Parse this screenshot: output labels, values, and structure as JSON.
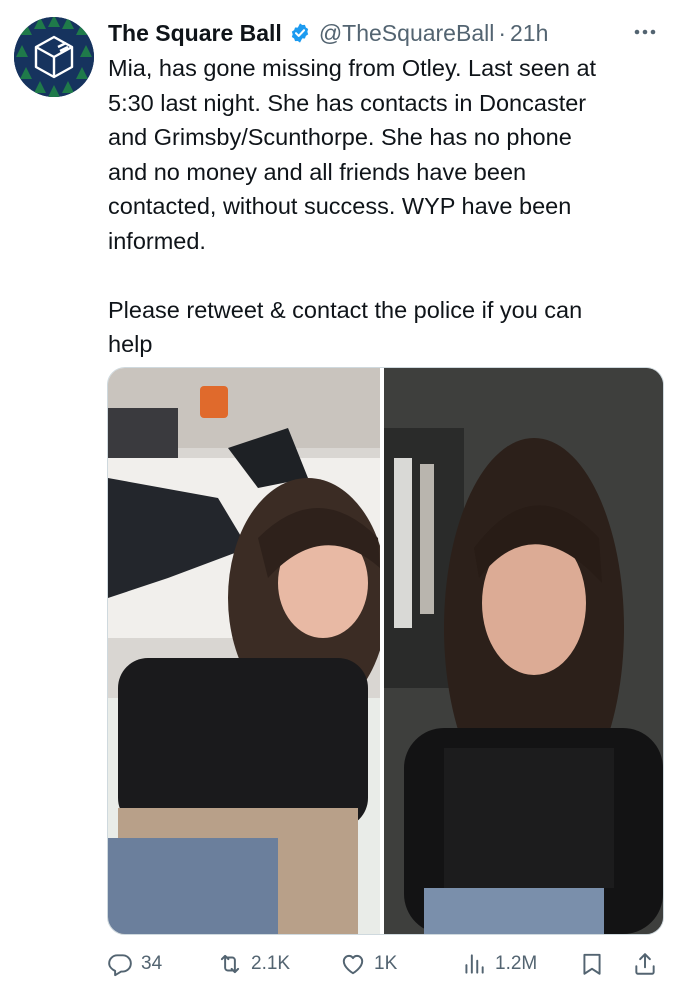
{
  "author": {
    "display_name": "The Square Ball",
    "handle": "@TheSquareBall",
    "separator": "·",
    "time": "21h",
    "verified": true
  },
  "tweet": {
    "text": "Mia, has gone missing from Otley. Last seen at\n5:30 last night. She has contacts in Doncaster\nand Grimsby/Scunthorpe. She has no phone\nand no money and all friends have been\ncontacted, without success. WYP have been\ninformed.\n\nPlease retweet & contact the police if you can\nhelp"
  },
  "media": {
    "count": 2,
    "photos": [
      "photo-1",
      "photo-2"
    ]
  },
  "actions": {
    "replies": "34",
    "retweets": "2.1K",
    "likes": "1K",
    "views": "1.2M"
  },
  "icons": {
    "more": "more-icon",
    "reply": "reply-icon",
    "retweet": "retweet-icon",
    "like": "heart-icon",
    "views": "views-icon",
    "bookmark": "bookmark-icon",
    "share": "share-icon",
    "verified": "verified-badge-icon"
  },
  "colors": {
    "text": "#0f1419",
    "secondary": "#536471",
    "verified": "#1d9bf0",
    "avatar_bg": "#13315c"
  }
}
